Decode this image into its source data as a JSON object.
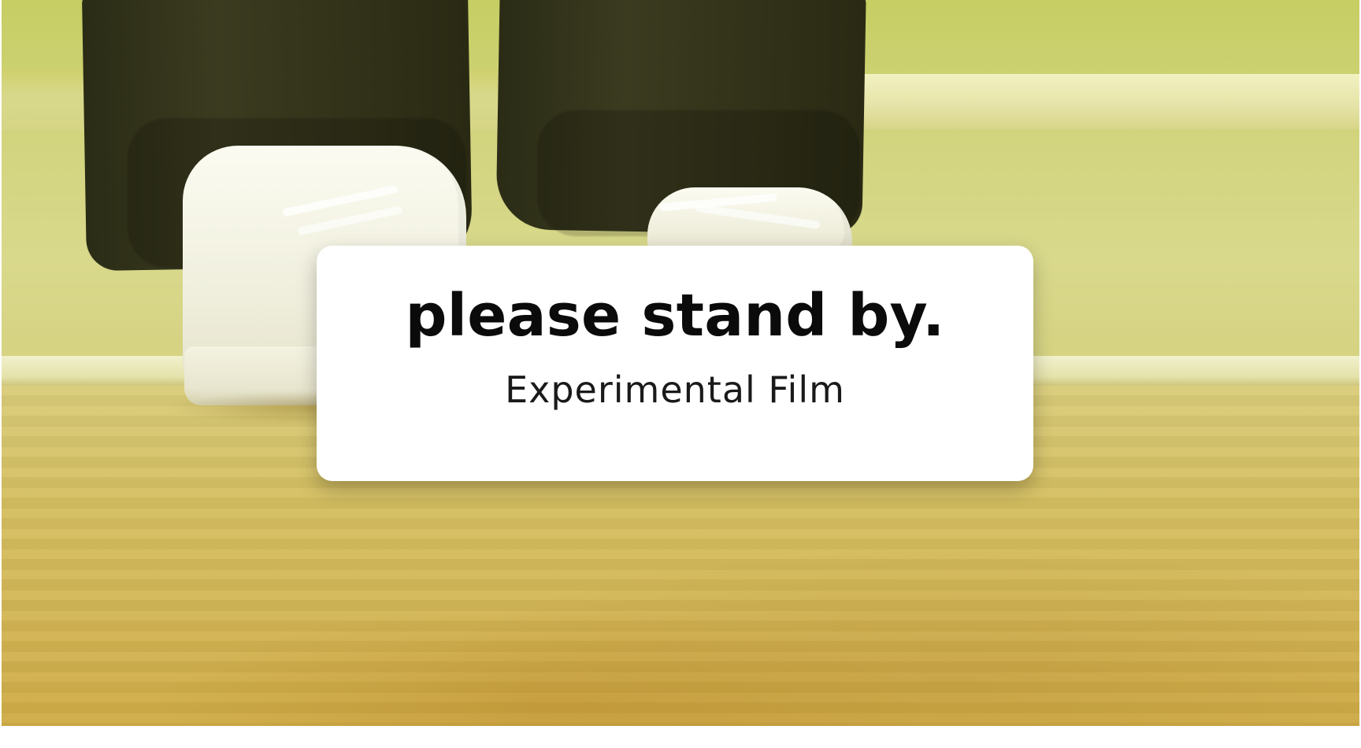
{
  "overlay": {
    "title": "please stand by.",
    "subtitle": "Experimental Film"
  },
  "colors": {
    "card_background": "#ffffff",
    "title_text": "#0b0b0b",
    "subtitle_text": "#1a1a1a",
    "wall_tint": "#d2d47e",
    "floor_tint": "#d3b656"
  }
}
